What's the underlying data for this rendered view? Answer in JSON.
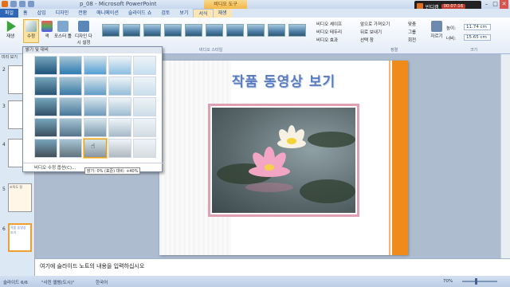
{
  "window": {
    "title": "p_08 - Microsoft PowerPoint",
    "context_tab_title": "비디오 도구",
    "recorder_label": "반디캠",
    "recorder_time": "00:07:16",
    "controls": [
      "–",
      "□",
      "✕"
    ]
  },
  "tabs": [
    "파일",
    "홈",
    "삽입",
    "디자인",
    "전환",
    "애니메이션",
    "슬라이드 쇼",
    "검토",
    "보기",
    "서식",
    "재생"
  ],
  "active_tab_index": 9,
  "ribbon": {
    "play_label": "재생",
    "corrections_label": "수정",
    "color_label": "색",
    "poster_label": "포스터 틀",
    "reset_label": "디자인 다시 설정",
    "group_preview": "미리 보기",
    "group_styles": "비디오 스타일",
    "group_arrange": "정렬",
    "group_size": "크기",
    "cmd_shape": "비디오 셰이프",
    "cmd_border": "비디오 테두리",
    "cmd_effects": "비디오 효과",
    "cmd_forward": "앞으로 가져오기",
    "cmd_backward": "뒤로 보내기",
    "cmd_selection": "선택 창",
    "cmd_align": "맞춤",
    "cmd_group": "그룹",
    "cmd_rotate": "회전",
    "crop_label": "자르기",
    "height_label": "높이:",
    "height_value": "11.74 cm",
    "width_label": "너비:",
    "width_value": "15.65 cm"
  },
  "gallery": {
    "header": "밝기 및 대비",
    "footer": "비디오 수정 옵션(C)...",
    "tooltip": "밝기: 0% (표준) 대비: +40%",
    "selected_cell": 22
  },
  "left_pane": {
    "tabs": "미리 보기",
    "slide_numbers": [
      "2",
      "3",
      "4",
      "5",
      "6"
    ],
    "slide5_title": "조직도 정",
    "slide6_title": "작품 동영상 보기"
  },
  "slide": {
    "title": "작품 동영상 보기"
  },
  "notes_placeholder": "여기에 슬라이드 노트의 내용을 입력하십시오",
  "status": {
    "slide_info": "슬라이드 6/6",
    "theme": "\"사진 앨범(도시)\"",
    "language": "한국어",
    "zoom": "70%"
  },
  "colors": {
    "accent_orange": "#f08a1a",
    "title_blue": "#5b7dbf",
    "frame_pink": "#e0a0b4",
    "file_tab": "#2f66b6"
  }
}
